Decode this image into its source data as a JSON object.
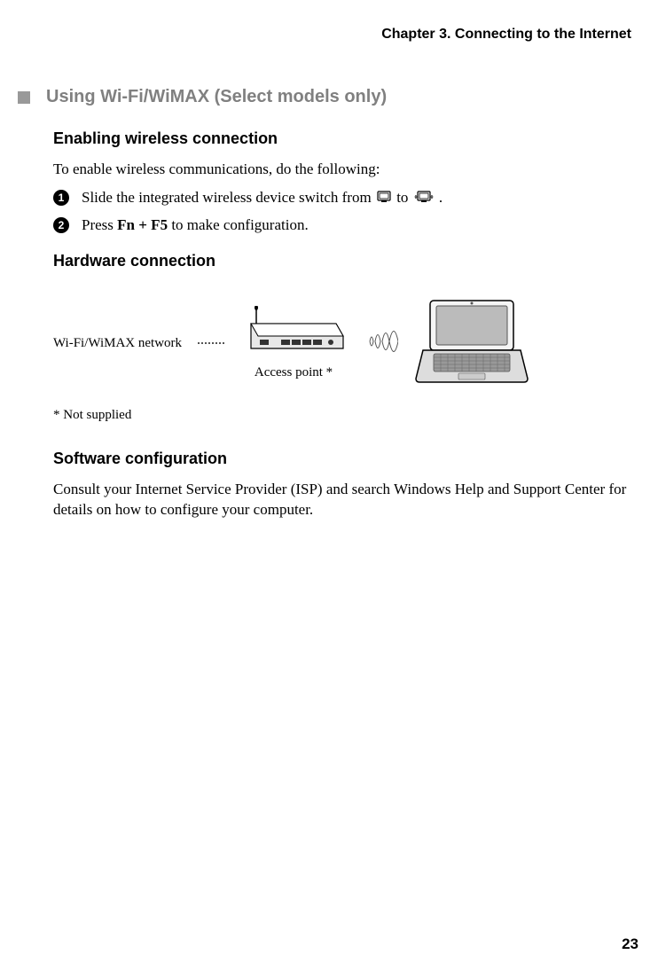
{
  "header": {
    "chapter": "Chapter 3. Connecting to the Internet"
  },
  "section": {
    "title": "Using Wi-Fi/WiMAX (Select models only)"
  },
  "subsections": {
    "enabling": {
      "heading": "Enabling wireless connection",
      "intro": "To enable wireless communications, do the following:",
      "steps": [
        {
          "num": "1",
          "text_pre": "Slide the integrated wireless device switch from ",
          "text_mid": " to ",
          "text_post": "."
        },
        {
          "num": "2",
          "text_pre": "Press ",
          "kbd": "Fn + F5",
          "text_post": " to make configuration."
        }
      ]
    },
    "hardware": {
      "heading": "Hardware connection",
      "network_label": "Wi-Fi/WiMAX network",
      "ap_caption": "Access point *",
      "footnote": "* Not supplied"
    },
    "software": {
      "heading": "Software configuration",
      "body": "Consult your Internet Service Provider (ISP) and search Windows Help and Support Center for details on how to configure your computer."
    }
  },
  "page_number": "23"
}
